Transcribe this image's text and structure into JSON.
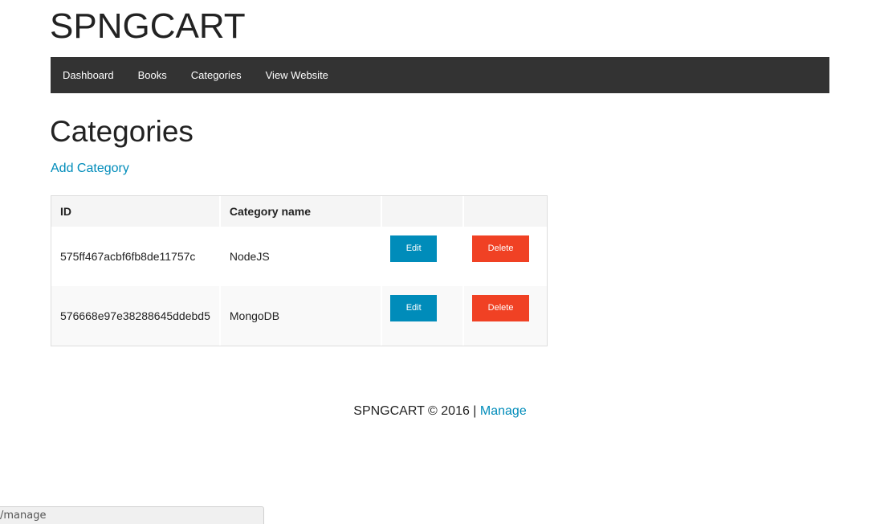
{
  "site": {
    "title": "SPNGCART"
  },
  "nav": {
    "items": [
      {
        "label": "Dashboard"
      },
      {
        "label": "Books"
      },
      {
        "label": "Categories"
      },
      {
        "label": "View Website"
      }
    ]
  },
  "main": {
    "heading": "Categories",
    "add_link": "Add Category",
    "table": {
      "headers": [
        "ID",
        "Category name",
        "",
        ""
      ],
      "rows": [
        {
          "id": "575ff467acbf6fb8de11757c",
          "name": "NodeJS",
          "edit": "Edit",
          "delete": "Delete"
        },
        {
          "id": "576668e97e38288645ddebd5",
          "name": "MongoDB",
          "edit": "Edit",
          "delete": "Delete"
        }
      ]
    }
  },
  "footer": {
    "text": "SPNGCART © 2016 | ",
    "link": "Manage"
  },
  "status_bar": {
    "url": "/manage"
  },
  "colors": {
    "nav_bg": "#333333",
    "link": "#008cba",
    "edit_button": "#008cba",
    "delete_button": "#f04124"
  }
}
